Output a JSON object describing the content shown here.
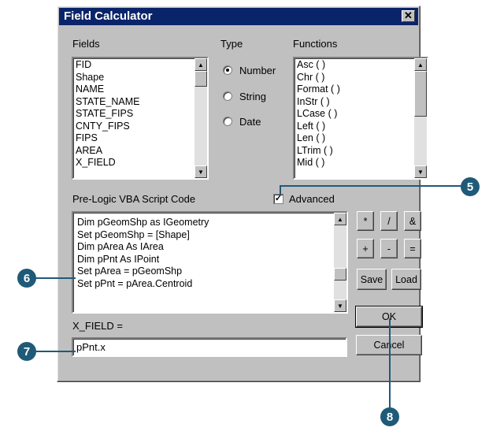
{
  "window": {
    "title": "Field Calculator",
    "close_glyph": "✕"
  },
  "fields": {
    "label": "Fields",
    "items": [
      "FID",
      "Shape",
      "NAME",
      "STATE_NAME",
      "STATE_FIPS",
      "CNTY_FIPS",
      "FIPS",
      "AREA",
      "X_FIELD"
    ]
  },
  "type": {
    "label": "Type",
    "options": [
      "Number",
      "String",
      "Date"
    ],
    "selected": "Number"
  },
  "functions": {
    "label": "Functions",
    "items": [
      "Asc ( )",
      "Chr ( )",
      "Format ( )",
      "InStr ( )",
      "LCase ( )",
      "Left ( )",
      "Len ( )",
      "LTrim ( )",
      "Mid ( )"
    ]
  },
  "prelogic": {
    "label": "Pre-Logic VBA Script Code",
    "lines": [
      "Dim pGeomShp as IGeometry",
      "Set pGeomShp = [Shape]",
      "Dim pArea As IArea",
      "Dim pPnt As IPoint",
      "Set pArea = pGeomShp",
      "Set pPnt = pArea.Centroid"
    ]
  },
  "advanced": {
    "label": "Advanced",
    "checked": true
  },
  "operators": [
    "*",
    "/",
    "&",
    "+",
    "-",
    "="
  ],
  "buttons": {
    "save": "Save",
    "load": "Load",
    "ok": "OK",
    "cancel": "Cancel"
  },
  "expression": {
    "label": "X_FIELD =",
    "value": "pPnt.x"
  },
  "callouts": [
    "5",
    "6",
    "7",
    "8"
  ],
  "colors": {
    "title_bar": "#0a246a",
    "dialog": "#c0c0c0",
    "callout": "#1f5a78"
  }
}
